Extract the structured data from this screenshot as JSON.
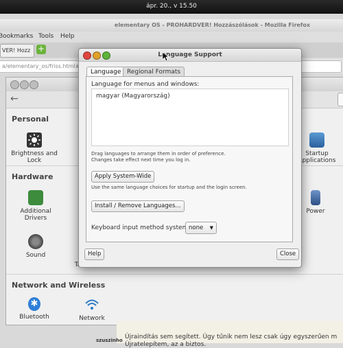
{
  "panel": {
    "clock": "ápr. 20., v 15.50"
  },
  "firefox": {
    "title": "elementary OS - PROHARDVER! Hozzászólások - Mozilla Firefox",
    "menu": [
      "Bookmarks",
      "Tools",
      "Help"
    ],
    "tab_label": "VER! Hozz",
    "new_tab": "+",
    "url": "a/elementary_os/friss.html#"
  },
  "system_settings": {
    "sections": {
      "personal": "Personal",
      "hardware": "Hardware",
      "network": "Network and Wireless"
    },
    "items": {
      "brightness": "Brightness and\nLock",
      "startup": "Startup\nApplications",
      "additional_drivers": "Additional\nDrivers",
      "power": "Power",
      "sound": "Sound",
      "tablet": "Tablet",
      "bluetooth": "Bluetooth",
      "network": "Network"
    }
  },
  "web": {
    "avatar_name": "szuszinho",
    "line1": "Újraindítás sem segített. Úgy tűnik nem lesz csak úgy egyszerűen m",
    "line2": "Újratelepítem, az a biztos."
  },
  "dialog": {
    "title": "Language Support",
    "tabs": [
      "Language",
      "Regional Formats"
    ],
    "language_label": "Language for menus and windows:",
    "languages": [
      "magyar (Magyarország)"
    ],
    "drag_note_1": "Drag languages to arrange them in order of preference.",
    "drag_note_2": "Changes take effect next time you log in.",
    "apply_button": "Apply System-Wide",
    "apply_note": "Use the same language choices for startup and the login screen.",
    "install_button": "Install / Remove Languages...",
    "keyboard_label": "Keyboard input method system:",
    "keyboard_value": "none",
    "help_button": "Help",
    "close_button": "Close"
  },
  "colors": {
    "close_dot": "#e0443e",
    "min_dot": "#dfa12b",
    "max_dot": "#5fb43b"
  }
}
